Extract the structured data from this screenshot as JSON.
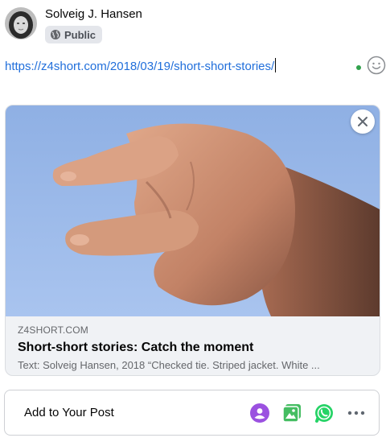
{
  "header": {
    "author_name": "Solveig J. Hansen",
    "privacy_label": "Public"
  },
  "composer": {
    "text": "https://z4short.com/2018/03/19/short-short-stories/"
  },
  "link_preview": {
    "domain": "Z4SHORT.COM",
    "title": "Short-short stories: Catch the moment",
    "description": "Text: Solveig Hansen, 2018 “Checked tie. Striped jacket. White ..."
  },
  "add_to_post": {
    "label": "Add to Your Post",
    "icons": [
      "tag-people-icon",
      "photo-video-icon",
      "whatsapp-icon",
      "more-icon"
    ]
  },
  "colors": {
    "link": "#216fdb",
    "online": "#31a24c",
    "tag_purple": "#9b51e0",
    "photo_green": "#45bd62",
    "whatsapp_green": "#25d366"
  }
}
